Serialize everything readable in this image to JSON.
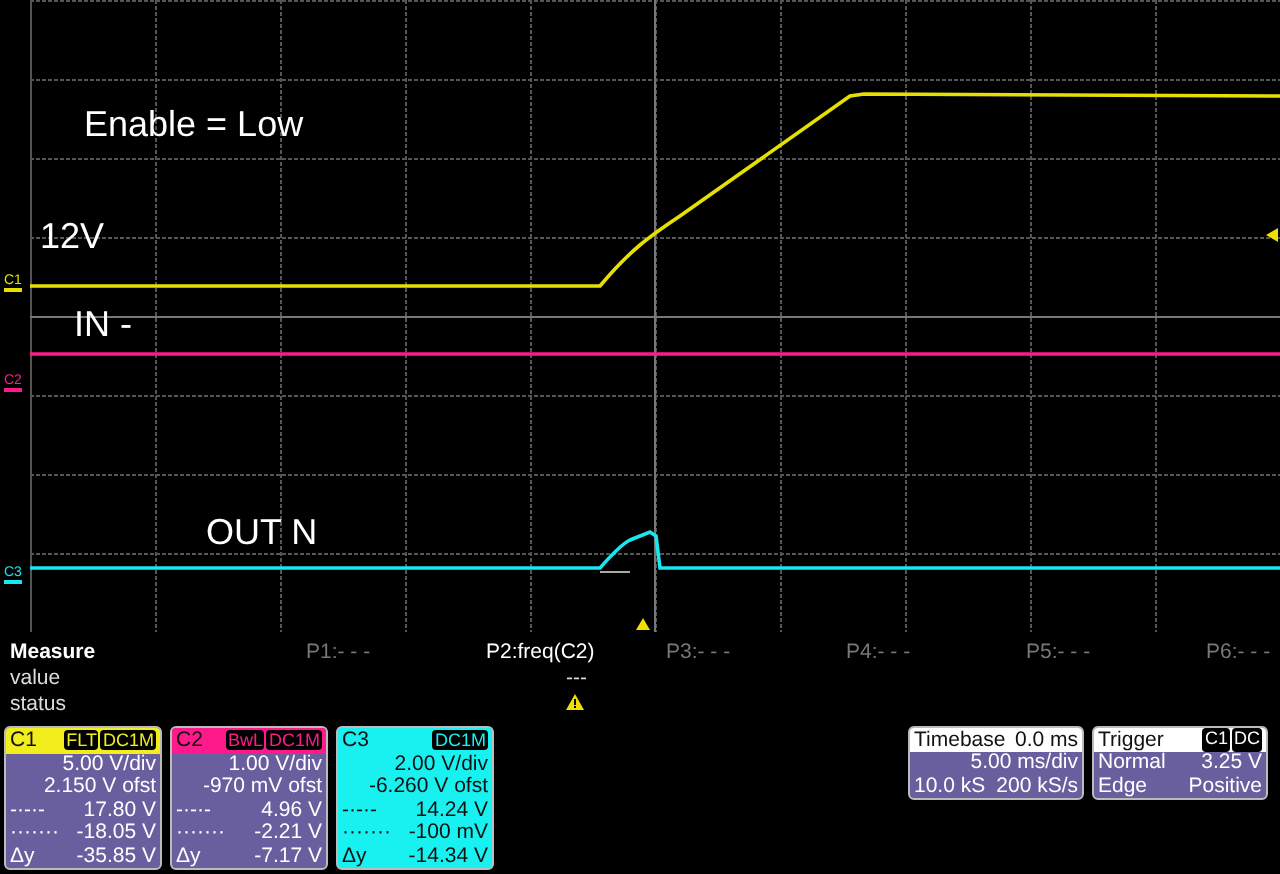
{
  "traces": [
    {
      "channel": "C1",
      "color": "#e6e000",
      "label": "12V"
    },
    {
      "channel": "C2",
      "color": "#ff1a8c",
      "label": "IN -"
    },
    {
      "channel": "C3",
      "color": "#19e6f0",
      "label": "OUT N"
    }
  ],
  "note": "Enable = Low",
  "measure": {
    "title": "Measure",
    "row_labels": [
      "value",
      "status"
    ],
    "params": [
      {
        "label": "P1:- - -",
        "active": false,
        "warning": false
      },
      {
        "label": "P2:freq(C2)",
        "active": true,
        "value": "---",
        "warning": true
      },
      {
        "label": "P3:- - -",
        "active": false,
        "warning": false
      },
      {
        "label": "P4:- - -",
        "active": false,
        "warning": false
      },
      {
        "label": "P5:- - -",
        "active": false,
        "warning": false
      },
      {
        "label": "P6:- - -",
        "active": false,
        "warning": false
      }
    ]
  },
  "channels": [
    {
      "name": "C1",
      "color": "#f2ee1e",
      "selected": false,
      "tags": [
        "FLT",
        "DC1M"
      ],
      "scale": "5.00 V/div",
      "offset": "2.150 V ofst",
      "rows": [
        {
          "symbol": "-·-·-",
          "value": "17.80 V"
        },
        {
          "symbol": "·······",
          "value": "-18.05 V"
        },
        {
          "symbol": "Δy",
          "value": "-35.85 V"
        }
      ]
    },
    {
      "name": "C2",
      "color": "#ff1a8c",
      "selected": false,
      "tags": [
        "BwL",
        "DC1M"
      ],
      "scale": "1.00 V/div",
      "offset": "-970 mV ofst",
      "rows": [
        {
          "symbol": "-·-·-",
          "value": "4.96 V"
        },
        {
          "symbol": "·······",
          "value": "-2.21 V"
        },
        {
          "symbol": "Δy",
          "value": "-7.17 V"
        }
      ]
    },
    {
      "name": "C3",
      "color": "#19f0f0",
      "selected": true,
      "tags": [
        "DC1M"
      ],
      "scale": "2.00 V/div",
      "offset": "-6.260 V ofst",
      "rows": [
        {
          "symbol": "-·-·-",
          "value": "14.24 V"
        },
        {
          "symbol": "·······",
          "value": "-100 mV"
        },
        {
          "symbol": "Δy",
          "value": "-14.34 V"
        }
      ]
    }
  ],
  "timebase": {
    "title": "Timebase",
    "delay": "0.0 ms",
    "per_div": "5.00 ms/div",
    "samples": "10.0 kS",
    "rate": "200 kS/s"
  },
  "trigger": {
    "title": "Trigger",
    "tags": [
      "C1",
      "DC"
    ],
    "mode": "Normal",
    "level": "3.25 V",
    "type": "Edge",
    "slope": "Positive"
  }
}
